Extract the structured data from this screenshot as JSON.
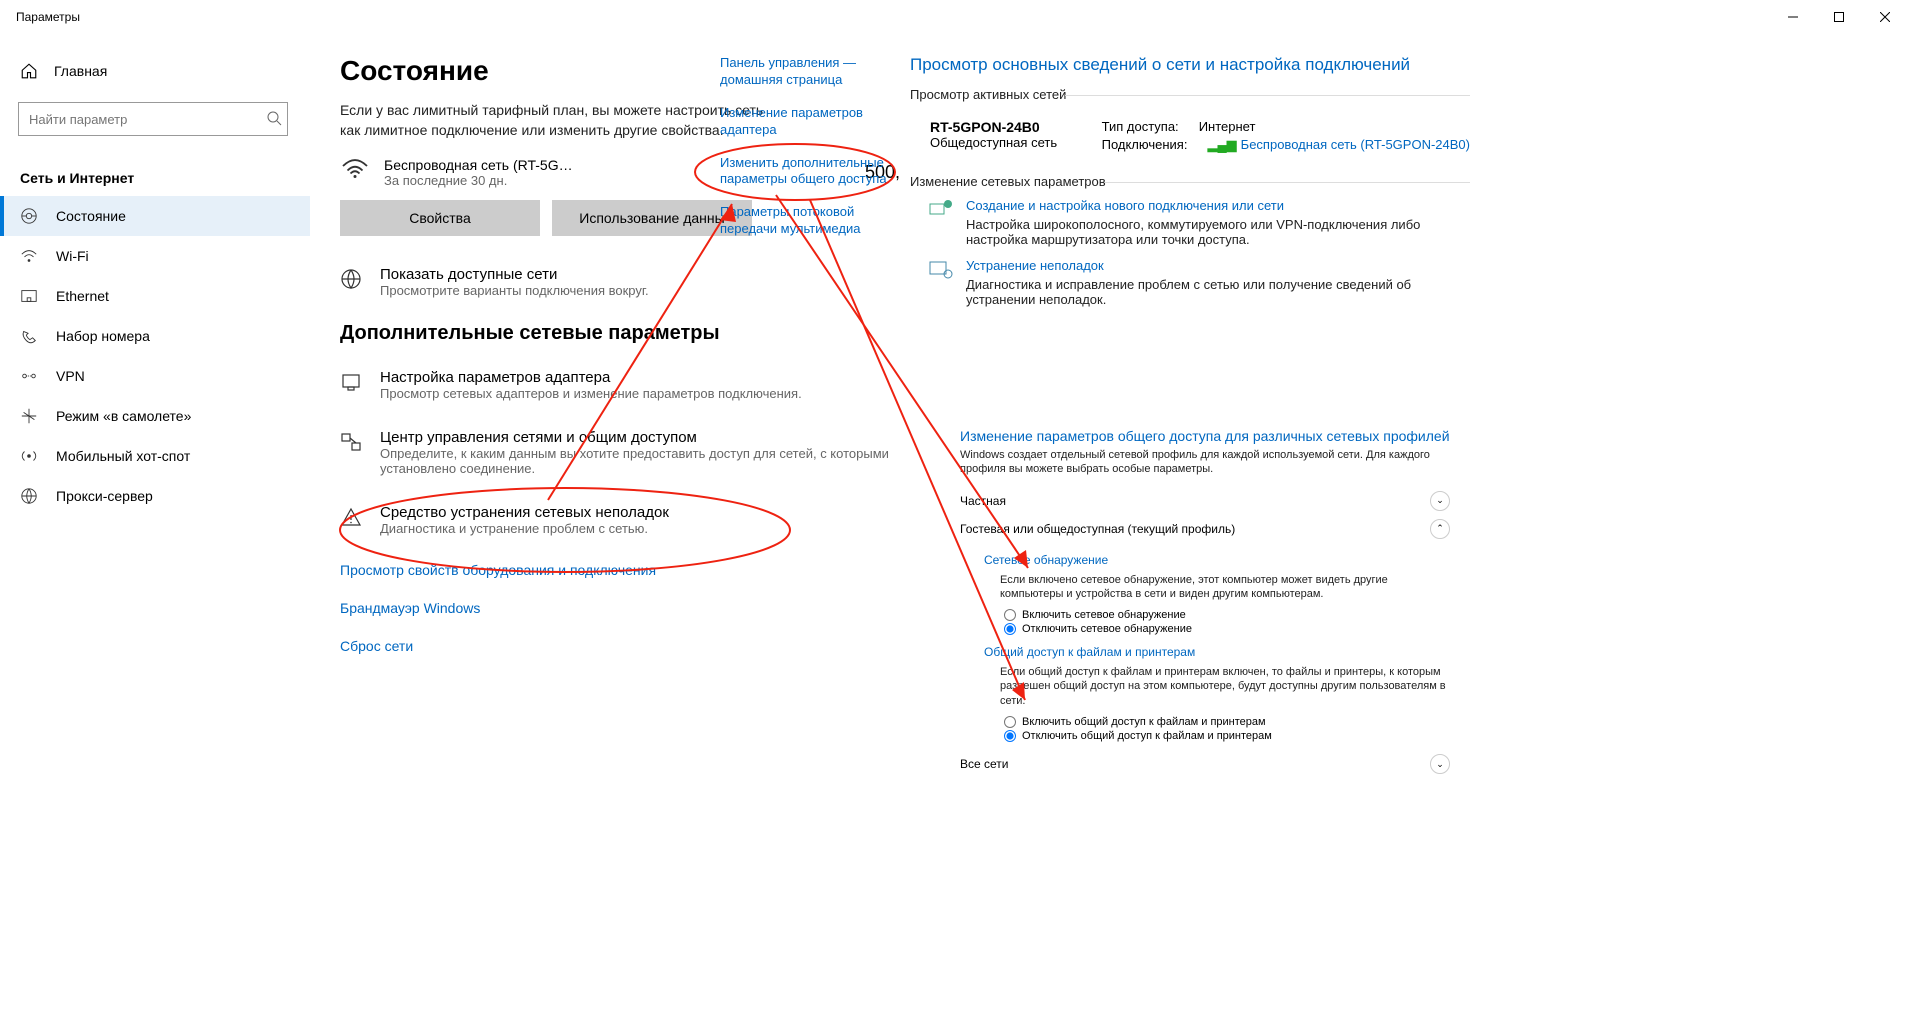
{
  "window": {
    "title": "Параметры"
  },
  "home": "Главная",
  "search": {
    "placeholder": "Найти параметр"
  },
  "sidebar": {
    "title": "Сеть и Интернет",
    "items": [
      {
        "label": "Состояние"
      },
      {
        "label": "Wi-Fi"
      },
      {
        "label": "Ethernet"
      },
      {
        "label": "Набор номера"
      },
      {
        "label": "VPN"
      },
      {
        "label": "Режим «в самолете»"
      },
      {
        "label": "Мобильный хот-спот"
      },
      {
        "label": "Прокси-сервер"
      }
    ]
  },
  "main": {
    "heading": "Состояние",
    "metered_desc": "Если у вас лимитный тарифный план, вы можете настроить сеть как лимитное подключение или изменить другие свойства.",
    "network": {
      "name": "Беспроводная сеть (RT-5G…",
      "period": "За последние 30 дн.",
      "usage": "500,"
    },
    "btn_props": "Свойства",
    "btn_usage": "Использование данны",
    "show_nets": {
      "title": "Показать доступные сети",
      "desc": "Просмотрите варианты подключения вокруг."
    },
    "h2": "Дополнительные сетевые параметры",
    "adapter": {
      "title": "Настройка параметров адаптера",
      "desc": "Просмотр сетевых адаптеров и изменение параметров подключения."
    },
    "nshare": {
      "title": "Центр управления сетями и общим доступом",
      "desc": "Определите, к каким данным вы хотите предоставить доступ для сетей, с которыми установлено соединение."
    },
    "tshoot": {
      "title": "Средство устранения сетевых неполадок",
      "desc": "Диагностика и устранение проблем с сетью."
    },
    "link1": "Просмотр свойств оборудования и подключения",
    "link2": "Брандмауэр Windows",
    "link3": "Сброс сети"
  },
  "cpl": {
    "l1": "Панель управления — домашняя страница",
    "l2": "Изменение параметров адаптера",
    "l3": "Изменить дополнительные параметры общего доступа",
    "l4": "Параметры потоковой передачи мультимедиа"
  },
  "nsc": {
    "heading": "Просмотр основных сведений о сети и настройка подключений",
    "fs1": "Просмотр активных сетей",
    "nn1": "RT-5GPON-24B0",
    "nn2": "Общедоступная сеть",
    "acc_type_l": "Тип доступа:",
    "acc_type_v": "Интернет",
    "conn_l": "Подключения:",
    "conn_v": "Беспроводная сеть (RT-5GPON-24B0)",
    "fs2": "Изменение сетевых параметров",
    "new_conn": {
      "title": "Создание и настройка нового подключения или сети",
      "desc": "Настройка широкополосного, коммутируемого или VPN-подключения либо настройка маршрутизатора или точки доступа."
    },
    "trouble": {
      "title": "Устранение неполадок",
      "desc": "Диагностика и исправление проблем с сетью или получение сведений об устранении неполадок."
    }
  },
  "adv": {
    "heading": "Изменение параметров общего доступа для различных сетевых профилей",
    "desc": "Windows создает отдельный сетевой профиль для каждой используемой сети. Для каждого профиля вы можете выбрать особые параметры.",
    "exp_private": "Частная",
    "exp_guest": "Гостевая или общедоступная (текущий профиль)",
    "sect1": {
      "label": "Сетевое обнаружение",
      "desc": "Если включено сетевое обнаружение, этот компьютер может видеть другие компьютеры и устройства в сети и виден другим компьютерам.",
      "r1": "Включить сетевое обнаружение",
      "r2": "Отключить сетевое обнаружение"
    },
    "sect2": {
      "label": "Общий доступ к файлам и принтерам",
      "desc": "Если общий доступ к файлам и принтерам включен, то файлы и принтеры, к которым разрешен общий доступ на этом компьютере, будут доступны другим пользователям в сети.",
      "r1": "Включить общий доступ к файлам и принтерам",
      "r2": "Отключить общий доступ к файлам и принтерам"
    },
    "exp_all": "Все сети"
  }
}
